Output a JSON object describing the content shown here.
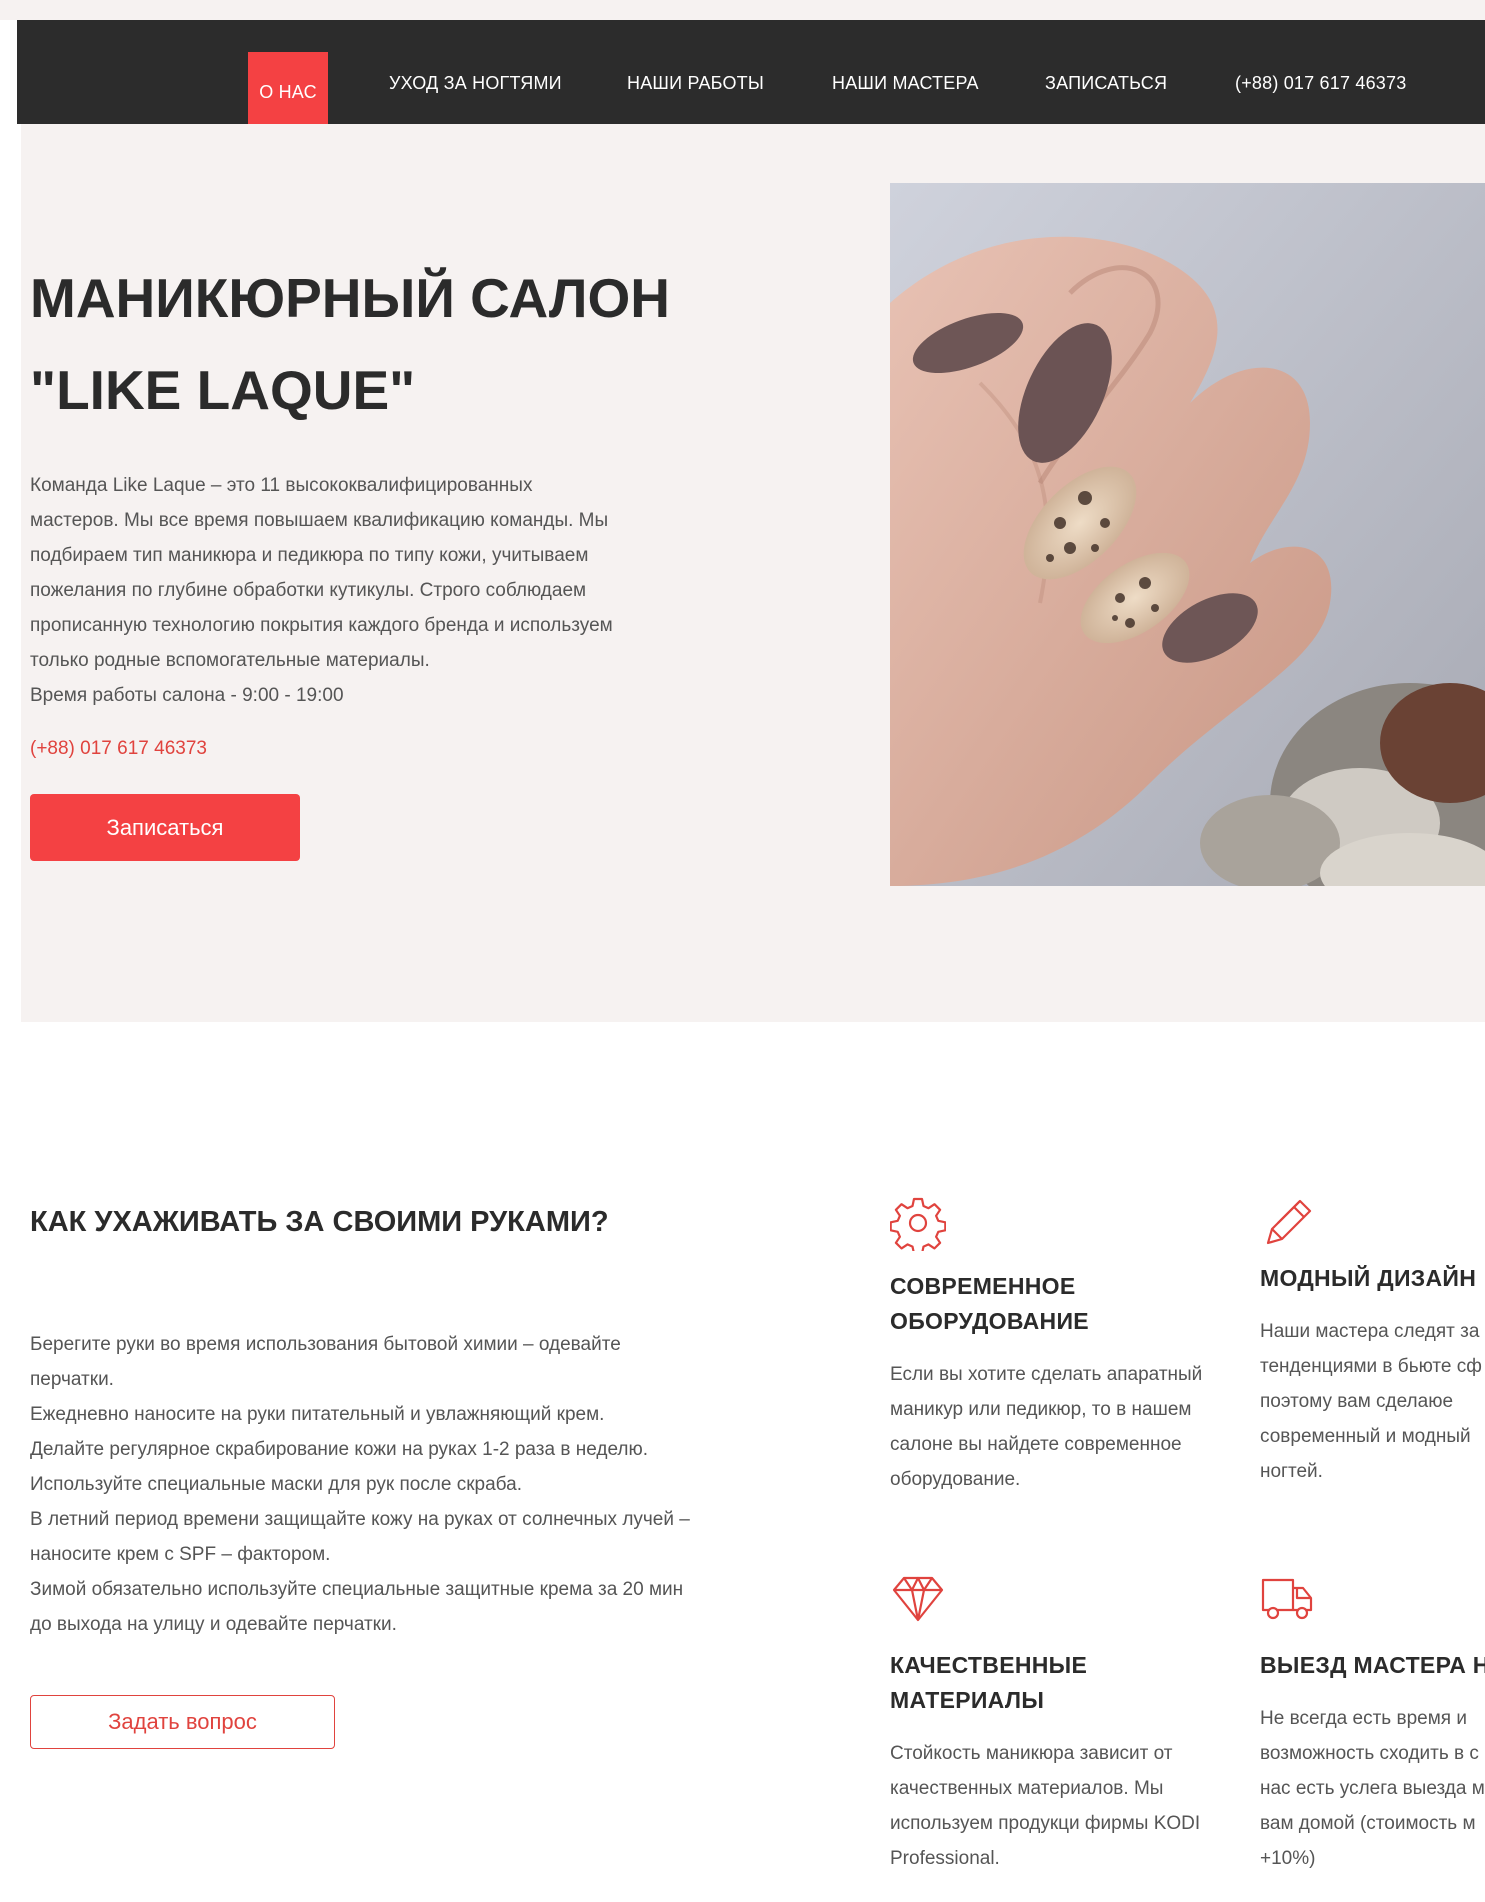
{
  "nav": {
    "items": [
      {
        "label": "О НАС",
        "active": true
      },
      {
        "label": "УХОД ЗА НОГТЯМИ"
      },
      {
        "label": "НАШИ РАБОТЫ"
      },
      {
        "label": "НАШИ МАСТЕРА"
      },
      {
        "label": "ЗАПИСАТЬСЯ"
      },
      {
        "label": "(+88) 017 617 46373"
      }
    ]
  },
  "hero": {
    "title_line1": "МАНИКЮРНЫЙ САЛОН",
    "title_line2": "\"LIKE LAQUE\"",
    "description_lines": [
      "Команда Like Laque – это 11 высококвалифицированных",
      "мастеров. Мы все время повышаем квалификацию команды. Мы",
      "подбираем тип маникюра и педикюра по типу кожи, учитываем",
      "пожелания по глубине обработки кутикулы. Строго соблюдаем",
      "прописанную технологию покрытия каждого бренда и используем",
      "только родные вспомогательные материалы."
    ],
    "hours": "Время работы салона - 9:00 - 19:00",
    "phone": "(+88) 017 617 46373",
    "cta_label": "Записаться"
  },
  "care": {
    "title": "КАК УХАЖИВАТЬ ЗА СВОИМИ РУКАМИ?",
    "lines": [
      "Берегите руки во время использования бытовой химии – одевайте",
      "перчатки.",
      "Ежедневно наносите на руки питательный и увлажняющий крем.",
      "Делайте регулярное скрабирование кожи на руках 1-2 раза в неделю.",
      "Используйте специальные маски для рук после скраба.",
      "В летний период времени защищайте кожу на руках от солнечных лучей –",
      "наносите крем с SPF – фактором.",
      "Зимой обязательно используйте специальные защитные крема за 20 мин",
      "до выхода на улицу и одевайте перчатки."
    ],
    "question_label": "Задать вопрос"
  },
  "features": [
    {
      "icon": "gear-icon",
      "title_lines": [
        "СОВРЕМЕННОЕ",
        "ОБОРУДОВАНИЕ"
      ],
      "text_lines": [
        "Если вы хотите сделать апаратный",
        "маникур или педикюр, то в нашем",
        "салоне вы найдете современное",
        "оборудование."
      ]
    },
    {
      "icon": "pencil-icon",
      "title_lines": [
        "МОДНЫЙ ДИЗАЙН"
      ],
      "text_lines": [
        "Наши мастера следят за",
        "тенденциями в бьюте сф",
        "поэтому вам сделаюе",
        "современный и модный",
        "ногтей."
      ]
    },
    {
      "icon": "diamond-icon",
      "title_lines": [
        "КАЧЕСТВЕННЫЕ",
        "МАТЕРИАЛЫ"
      ],
      "text_lines": [
        "Стойкость маникюра зависит от",
        "качественных материалов. Мы",
        "используем продукци фирмы KODI",
        "Professional."
      ]
    },
    {
      "icon": "truck-icon",
      "title_lines": [
        "ВЫЕЗД МАСТЕРА Н"
      ],
      "text_lines": [
        "Не всегда есть время и",
        "возможность сходить в с",
        "нас есть услега выезда м",
        "вам домой (стоимость м",
        "+10%)"
      ]
    }
  ],
  "colors": {
    "accent": "#f44143",
    "nav_bg": "#2c2c2c",
    "hero_bg": "#f6f2f1",
    "text_dark": "#2b2b2b",
    "text_muted": "#555555"
  }
}
